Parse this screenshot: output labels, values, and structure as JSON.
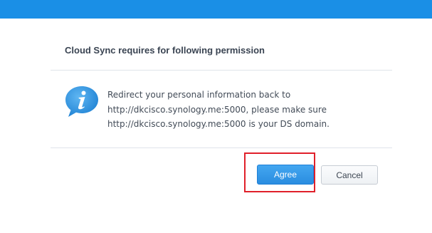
{
  "dialog": {
    "title": "Cloud Sync requires for following permission",
    "message_lines": [
      "Redirect your personal information back to",
      "http://dkcisco.synology.me:5000, please make sure",
      "http://dkcisco.synology.me:5000 is your DS domain."
    ],
    "icon": "info-icon",
    "agree_label": "Agree",
    "cancel_label": "Cancel"
  },
  "colors": {
    "topbar": "#1a8fe6",
    "primary_button": "#2a8de0",
    "highlight_outline": "#e0202a"
  }
}
